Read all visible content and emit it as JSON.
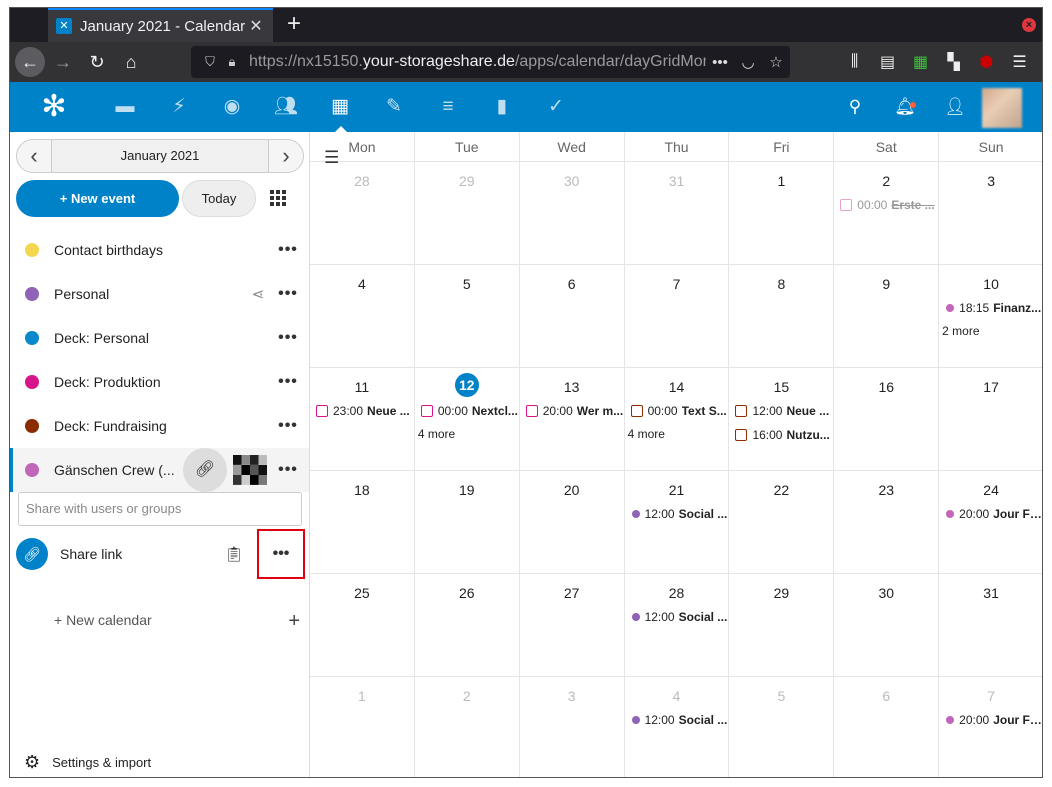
{
  "browser": {
    "tab_title": "January 2021 - Calendar - ",
    "tab_close": "✕",
    "new_tab": "+",
    "url_host": "https://nx15150.",
    "url_domain": "your-storageshare.de",
    "url_path": "/apps/calendar/dayGridMont",
    "url_more": "•••"
  },
  "header": {
    "apps": [
      "files",
      "activity",
      "search-app",
      "contacts",
      "calendar",
      "notes",
      "deck",
      "analytics",
      "tasks"
    ],
    "active_app": "calendar"
  },
  "sidebar": {
    "month_label": "January 2021",
    "new_event_label": "+ New event",
    "today_label": "Today",
    "calendars": [
      {
        "name": "Contact birthdays",
        "color": "#f3d74f"
      },
      {
        "name": "Personal",
        "color": "#8f63b5"
      },
      {
        "name": "Deck: Personal",
        "color": "#0b88c9"
      },
      {
        "name": "Deck: Produktion",
        "color": "#d6148b"
      },
      {
        "name": "Deck: Fundraising",
        "color": "#8a2c00"
      },
      {
        "name": "Gänschen Crew (...",
        "color": "#c266b9"
      }
    ],
    "share_placeholder": "Share with users or groups",
    "share_link_label": "Share link",
    "new_calendar_label": "+ New calendar",
    "settings_label": "Settings & import"
  },
  "calendar": {
    "weekdays": [
      "Mon",
      "Tue",
      "Wed",
      "Thu",
      "Fri",
      "Sat",
      "Sun"
    ],
    "weeks": [
      [
        {
          "n": "28",
          "other": true
        },
        {
          "n": "29",
          "other": true
        },
        {
          "n": "30",
          "other": true
        },
        {
          "n": "31",
          "other": true
        },
        {
          "n": "1"
        },
        {
          "n": "2",
          "events": [
            {
              "time": "00:00",
              "title": "Erste ...",
              "marker": "box",
              "color": "#e8a3cd",
              "faded": true
            }
          ]
        },
        {
          "n": "3"
        }
      ],
      [
        {
          "n": "4"
        },
        {
          "n": "5"
        },
        {
          "n": "6"
        },
        {
          "n": "7"
        },
        {
          "n": "8"
        },
        {
          "n": "9"
        },
        {
          "n": "10",
          "events": [
            {
              "time": "18:15",
              "title": "Finanz...",
              "marker": "dot",
              "color": "#c266b9"
            }
          ],
          "more": "2 more"
        }
      ],
      [
        {
          "n": "11",
          "events": [
            {
              "time": "23:00",
              "title": "Neue ...",
              "marker": "box",
              "color": "#d6148b"
            }
          ]
        },
        {
          "n": "12",
          "today": true,
          "events": [
            {
              "time": "00:00",
              "title": "Nextcl...",
              "marker": "box",
              "color": "#d6148b"
            }
          ],
          "more": "4 more"
        },
        {
          "n": "13",
          "events": [
            {
              "time": "20:00",
              "title": "Wer m...",
              "marker": "box",
              "color": "#d6148b"
            }
          ]
        },
        {
          "n": "14",
          "events": [
            {
              "time": "00:00",
              "title": "Text S...",
              "marker": "box",
              "color": "#8a2c00"
            }
          ],
          "more": "4 more"
        },
        {
          "n": "15",
          "events": [
            {
              "time": "12:00",
              "title": "Neue ...",
              "marker": "box",
              "color": "#8a2c00"
            },
            {
              "time": "16:00",
              "title": "Nutzu...",
              "marker": "box",
              "color": "#8a2c00"
            }
          ]
        },
        {
          "n": "16"
        },
        {
          "n": "17"
        }
      ],
      [
        {
          "n": "18"
        },
        {
          "n": "19"
        },
        {
          "n": "20"
        },
        {
          "n": "21",
          "events": [
            {
              "time": "12:00",
              "title": "Social ...",
              "marker": "dot",
              "color": "#8f63b5"
            }
          ]
        },
        {
          "n": "22"
        },
        {
          "n": "23"
        },
        {
          "n": "24",
          "events": [
            {
              "time": "20:00",
              "title": "Jour Fi...",
              "marker": "dot",
              "color": "#c266b9"
            }
          ]
        }
      ],
      [
        {
          "n": "25"
        },
        {
          "n": "26"
        },
        {
          "n": "27"
        },
        {
          "n": "28",
          "events": [
            {
              "time": "12:00",
              "title": "Social ...",
              "marker": "dot",
              "color": "#8f63b5"
            }
          ]
        },
        {
          "n": "29"
        },
        {
          "n": "30"
        },
        {
          "n": "31"
        }
      ],
      [
        {
          "n": "1",
          "other": true
        },
        {
          "n": "2",
          "other": true
        },
        {
          "n": "3",
          "other": true
        },
        {
          "n": "4",
          "other": true,
          "events": [
            {
              "time": "12:00",
              "title": "Social ...",
              "marker": "dot",
              "color": "#8f63b5"
            }
          ]
        },
        {
          "n": "5",
          "other": true
        },
        {
          "n": "6",
          "other": true
        },
        {
          "n": "7",
          "other": true,
          "events": [
            {
              "time": "20:00",
              "title": "Jour Fi...",
              "marker": "dot",
              "color": "#c266b9"
            }
          ]
        }
      ]
    ]
  },
  "colors": {
    "brand": "#0082c9",
    "highlight": "#e0000f"
  }
}
